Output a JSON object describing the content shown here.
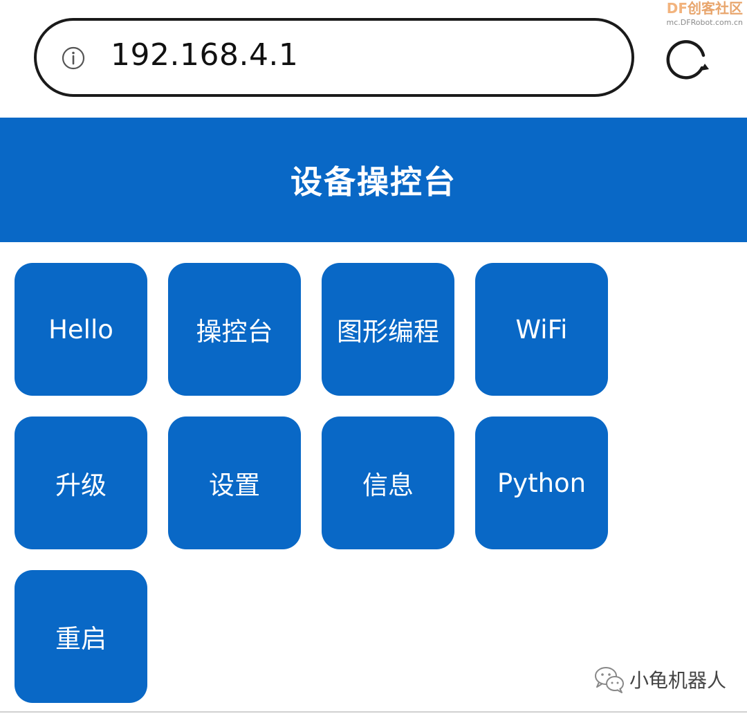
{
  "watermark_top": {
    "brand_df": "DF",
    "brand_text": "创客社区",
    "url": "mc.DFRobot.com.cn"
  },
  "browser": {
    "url": "192.168.4.1",
    "info_icon": "info-icon",
    "reload_icon": "reload-icon"
  },
  "header": {
    "title": "设备操控台"
  },
  "tiles": [
    {
      "label": "Hello"
    },
    {
      "label": "操控台"
    },
    {
      "label": "图形编程"
    },
    {
      "label": "WiFi"
    },
    {
      "label": "升级"
    },
    {
      "label": "设置"
    },
    {
      "label": "信息"
    },
    {
      "label": "Python"
    },
    {
      "label": "重启"
    }
  ],
  "watermark_bottom": {
    "icon": "wechat-icon",
    "label": "小龟机器人"
  },
  "colors": {
    "primary": "#0968c6",
    "text_on_primary": "#ffffff",
    "address_border": "#1a1a1a",
    "watermark_orange": "#e8a56c"
  }
}
